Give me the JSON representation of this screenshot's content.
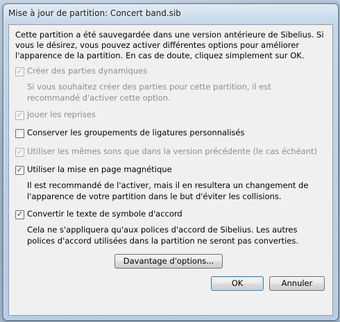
{
  "window": {
    "title": "Mise à jour de partition: Concert band.sib"
  },
  "intro": {
    "lines": [
      "Cette partition a été sauvegardée dans une version antérieure de Sibelius. Si",
      "vous le désirez, vous pouvez activer différentes options pour améliorer",
      "l'apparence de la partition. En cas de doute, cliquez simplement sur OK."
    ]
  },
  "options": [
    {
      "label": "Créer des parties dynamiques",
      "checked": true,
      "enabled": false,
      "note": [
        "Si vous souhaitez créer des parties pour cette partition, il est",
        "recommandé d'activer cette option."
      ]
    },
    {
      "label": "Jouer les reprises",
      "checked": true,
      "enabled": false,
      "note": []
    },
    {
      "label": "Conserver les groupements de ligatures personnalisés",
      "checked": false,
      "enabled": true,
      "note": []
    },
    {
      "label": "Utiliser les mêmes sons que dans la version précédente (le cas échéant)",
      "checked": true,
      "enabled": false,
      "note": []
    },
    {
      "label": "Utiliser la mise en page magnétique",
      "checked": true,
      "enabled": true,
      "note": [
        "Il est recommandé de l'activer, mais il en resultera un changement de",
        "l'apparence de votre partition dans le but d'éviter les collisions."
      ]
    },
    {
      "label": "Convertir le texte de symbole d'accord",
      "checked": true,
      "enabled": true,
      "note": [
        "Cela ne s'appliquera qu'aux polices d'accord de Sibelius. Les autres",
        "polices d'accord utilisées dans la partition ne seront pas converties."
      ]
    }
  ],
  "buttons": {
    "more": "Davantage d'options...",
    "ok": "OK",
    "cancel": "Annuler"
  },
  "icons": {
    "checkmark": "check-icon"
  }
}
